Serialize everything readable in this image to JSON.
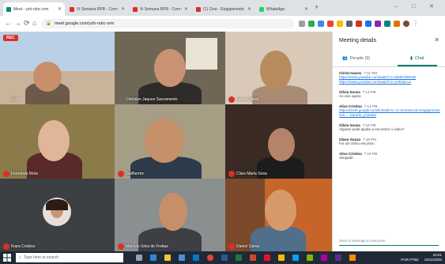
{
  "browser": {
    "tabs": [
      {
        "title": "Meet - yzh-rsbc-vrm",
        "active": true,
        "favicon_color": "#00897b"
      },
      {
        "title": "Vi Semana RPB - Com es...",
        "active": false,
        "favicon_color": "#d93025"
      },
      {
        "title": "Vi Semana RPB - Com es...",
        "active": false,
        "favicon_color": "#d93025"
      },
      {
        "title": "(1) Cine - Engajamento e...",
        "active": false,
        "favicon_color": "#d93025"
      },
      {
        "title": "WhatsApp",
        "active": false,
        "favicon_color": "#25d366"
      }
    ],
    "new_tab": "+",
    "window_controls": "–  □  ✕",
    "url": "meet.google.com/yzh-rsbc-vrm",
    "nav": {
      "back": "←",
      "forward": "→",
      "reload": "⟳",
      "home": "⌂"
    }
  },
  "meeting": {
    "rec_label": "REC",
    "participants": [
      {
        "name": "Gui",
        "muted": false
      },
      {
        "name": "Christian Jaques Sacramento",
        "muted": false
      },
      {
        "name": "Luiza Cabral",
        "muted": true
      },
      {
        "name": "Fernanda Mota",
        "muted": true
      },
      {
        "name": "Guilherme",
        "muted": true
      },
      {
        "name": "Clara Maria Sosa",
        "muted": true
      },
      {
        "name": "Kiara Cristina",
        "muted": true
      },
      {
        "name": "Marcelo Silva de Freitas",
        "muted": true
      },
      {
        "name": "Daniel Gama",
        "muted": true
      }
    ]
  },
  "panel": {
    "title": "Meeting details",
    "close": "✕",
    "people_tab": "People (9)",
    "chat_tab": "Chat",
    "messages": [
      {
        "author": "Christ Ivanov",
        "time": "7:11 PM",
        "text": "https://www.youtube.com/watch?v=tbMhVbkRskI",
        "link": true
      },
      {
        "author": "",
        "time": "",
        "text": "https://www.youtube.com/watch?v=yHDqlx-ux",
        "link": true
      },
      {
        "author": "Olivia Souza",
        "time": "7:13 PM",
        "text": "Ao vivo agora",
        "link": false
      },
      {
        "author": "Alice Cristina",
        "time": "7:14 PM",
        "text": "https://meet.google.com/linkedin?c=Vi Semana de Engajamento nos ... esporte_youtube",
        "link": true
      },
      {
        "author": "Olivia Souza",
        "time": "7:16 PM",
        "text": "Alguem pode ajudar a encontrar o video?",
        "link": false
      },
      {
        "author": "Olavo Souza",
        "time": "7:18 PM",
        "text": "Foi um ótimo encontro",
        "link": false
      },
      {
        "author": "Alice Cristina",
        "time": "7:19 PM",
        "text": "obrigada",
        "link": false
      }
    ],
    "input_placeholder": "Send a message to everyone"
  },
  "taskbar": {
    "search_placeholder": "Type here to search",
    "time": "20:51",
    "date": "16/11/2020",
    "lang": "POR PTB2"
  },
  "colors": {
    "accent": "#00796b",
    "mute_red": "#d93025",
    "link": "#1a73e8"
  }
}
